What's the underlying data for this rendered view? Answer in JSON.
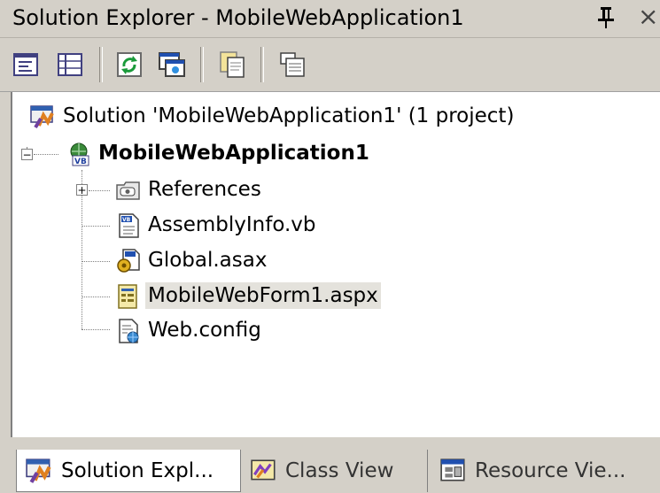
{
  "window": {
    "title": "Solution Explorer - MobileWebApplication1",
    "pin_icon": "pushpin-icon",
    "close_label": "×"
  },
  "toolbar": {
    "buttons": [
      {
        "name": "view-code-icon"
      },
      {
        "name": "properties-icon"
      },
      {
        "name": "refresh-icon"
      },
      {
        "name": "view-designer-icon"
      },
      {
        "name": "copy-project-icon"
      },
      {
        "name": "show-all-files-icon"
      }
    ]
  },
  "tree": {
    "solution_label": "Solution 'MobileWebApplication1' (1 project)",
    "project_label": "MobileWebApplication1",
    "project_expander": "−",
    "references_expander": "+",
    "items": [
      {
        "label": "References",
        "icon": "references-folder-icon"
      },
      {
        "label": "AssemblyInfo.vb",
        "icon": "vb-file-icon"
      },
      {
        "label": "Global.asax",
        "icon": "global-asax-icon"
      },
      {
        "label": "MobileWebForm1.aspx",
        "icon": "mobile-webform-icon",
        "selected": true
      },
      {
        "label": "Web.config",
        "icon": "config-file-icon"
      }
    ]
  },
  "tabs": [
    {
      "label": "Solution Expl...",
      "icon": "solution-icon",
      "active": true
    },
    {
      "label": "Class View",
      "icon": "class-view-icon",
      "active": false
    },
    {
      "label": "Resource Vie...",
      "icon": "resource-view-icon",
      "active": false
    }
  ],
  "colors": {
    "chrome": "#d4d0c8",
    "panel": "#ffffff",
    "selection": "#e4e2dc"
  }
}
